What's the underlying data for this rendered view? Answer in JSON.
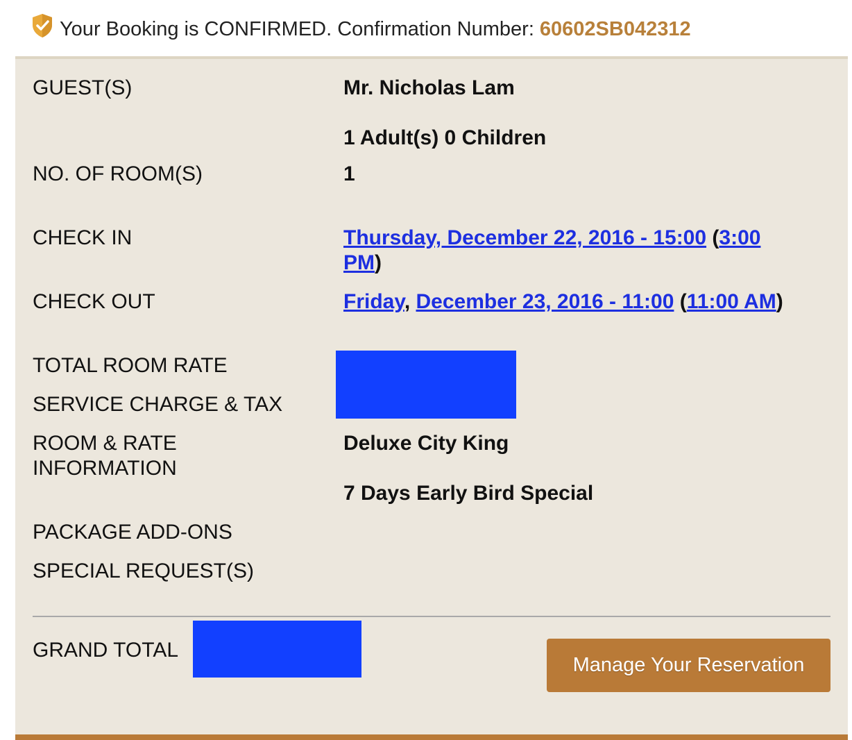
{
  "header": {
    "confirmation_text": "Your Booking is CONFIRMED. Confirmation Number:",
    "confirmation_number": "60602SB042312",
    "accent_color": "#b8803a"
  },
  "fields": {
    "guests_label": "GUEST(S)",
    "guest_name": "Mr. Nicholas Lam",
    "guest_count": "1 Adult(s) 0 Children",
    "rooms_label": "NO. OF ROOM(S)",
    "rooms_value": "1",
    "checkin_label": "CHECK IN",
    "checkin_date_link": "Thursday, December 22, 2016 - 15:00",
    "checkin_time_link_part1": "3:00",
    "checkin_time_link_part2": "PM",
    "checkout_label": "CHECK OUT",
    "checkout_day_link": "Friday",
    "checkout_date_link": "December 23, 2016 - 11:00",
    "checkout_time_link": "11:00 AM",
    "total_rate_label": "TOTAL ROOM RATE",
    "service_tax_label": "SERVICE CHARGE & TAX",
    "room_rate_info_label_line1": "ROOM & RATE",
    "room_rate_info_label_line2": "INFORMATION",
    "room_type": "Deluxe City King",
    "rate_plan": "7 Days Early Bird Special",
    "package_addons_label": "PACKAGE ADD-ONS",
    "special_requests_label": "SPECIAL REQUEST(S)",
    "grand_total_label": "GRAND TOTAL"
  },
  "actions": {
    "manage_button_label": "Manage Your Reservation"
  },
  "colors": {
    "panel_background": "#ece7dd",
    "link_color": "#1d2fe0",
    "button_color": "#b97a37",
    "redaction_color": "#1240ff"
  }
}
